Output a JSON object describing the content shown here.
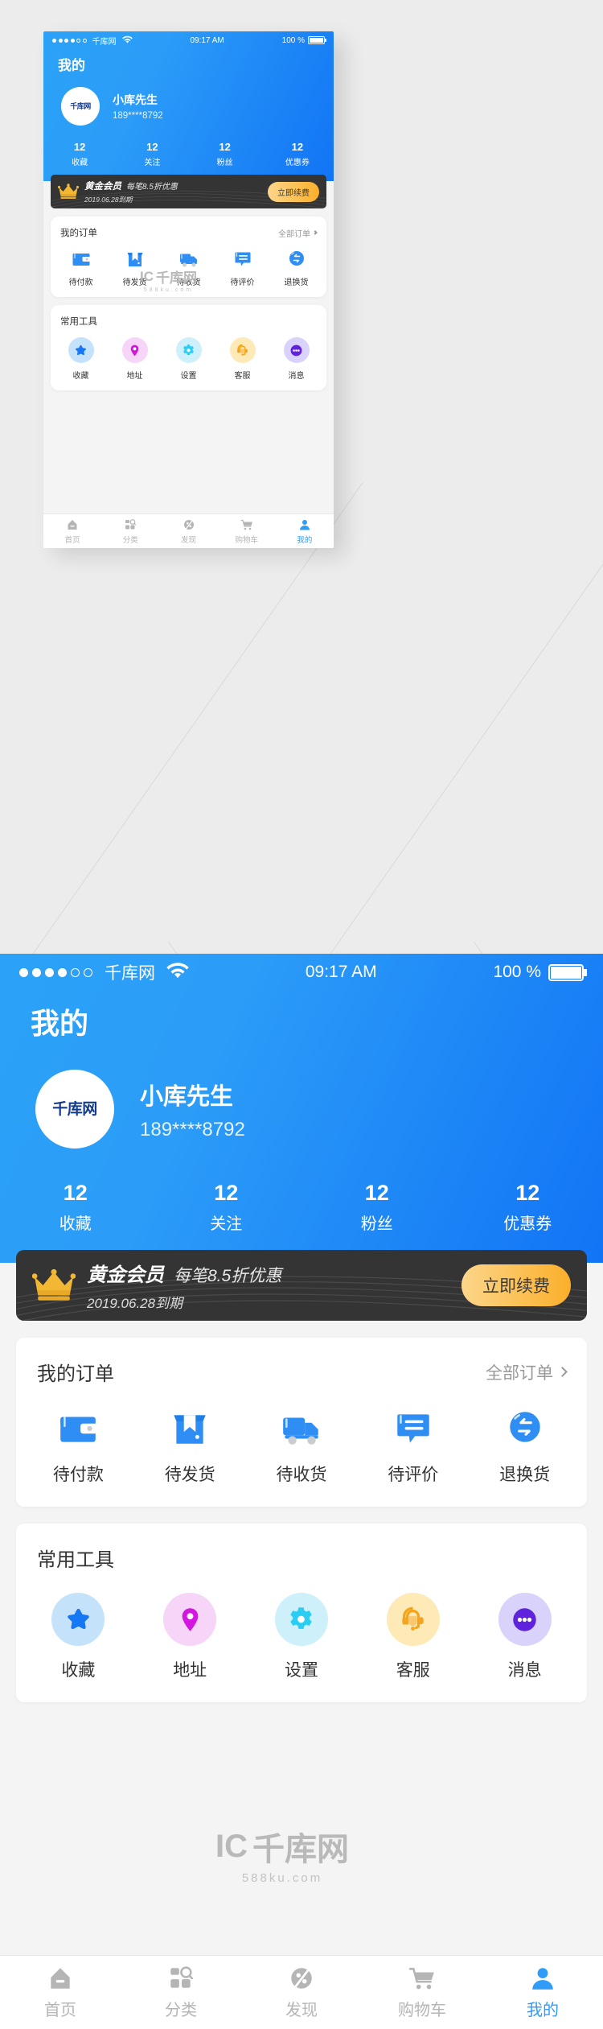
{
  "app": {
    "screen_title": "我的",
    "accent_color": "#2f9cf8",
    "hero_gradient_from": "#2ba2f7",
    "hero_gradient_to": "#1274f5"
  },
  "status_bar": {
    "carrier": "千库网",
    "signal_dots_filled": 4,
    "signal_dots_total": 6,
    "wifi_icon": "wifi-icon",
    "time": "09:17 AM",
    "battery_text": "100 %",
    "battery_level": 100
  },
  "profile": {
    "avatar_logo_text": "千库网",
    "name": "小库先生",
    "phone": "189****8792"
  },
  "stats": [
    {
      "value": "12",
      "label": "收藏"
    },
    {
      "value": "12",
      "label": "关注"
    },
    {
      "value": "12",
      "label": "粉丝"
    },
    {
      "value": "12",
      "label": "优惠券"
    }
  ],
  "vip_banner": {
    "crown_icon": "crown-icon",
    "title": "黄金会员",
    "subtitle": "每笔8.5折优惠",
    "expiry": "2019.06.28到期",
    "renew_label": "立即续费",
    "background_color": "#343434",
    "button_gradient_from": "#fcd68a",
    "button_gradient_to": "#fbaf2a"
  },
  "orders_card": {
    "title": "我的订单",
    "more_label": "全部订单",
    "more_icon": "chevron-right-icon",
    "items": [
      {
        "label": "待付款",
        "icon": "wallet-icon"
      },
      {
        "label": "待发货",
        "icon": "package-icon"
      },
      {
        "label": "待收货",
        "icon": "truck-icon"
      },
      {
        "label": "待评价",
        "icon": "comment-icon"
      },
      {
        "label": "退换货",
        "icon": "return-icon"
      }
    ]
  },
  "tools_card": {
    "title": "常用工具",
    "items": [
      {
        "label": "收藏",
        "icon": "star-icon",
        "bg": "#c5e2fb",
        "fg": "#1677f5"
      },
      {
        "label": "地址",
        "icon": "location-pin-icon",
        "bg": "#f6d5f8",
        "fg": "#d317e0"
      },
      {
        "label": "设置",
        "icon": "gear-icon",
        "bg": "#cdf0fb",
        "fg": "#2ccdf3"
      },
      {
        "label": "客服",
        "icon": "headset-icon",
        "bg": "#fdeab6",
        "fg": "#f6a41c"
      },
      {
        "label": "消息",
        "icon": "message-dots-icon",
        "bg": "#d9d2fb",
        "fg": "#5f22dd"
      }
    ]
  },
  "tabbar": {
    "items": [
      {
        "label": "首页",
        "icon": "home-icon",
        "active": false
      },
      {
        "label": "分类",
        "icon": "category-icon",
        "active": false
      },
      {
        "label": "发现",
        "icon": "discover-icon",
        "active": false
      },
      {
        "label": "购物车",
        "icon": "cart-icon",
        "active": false
      },
      {
        "label": "我的",
        "icon": "user-icon",
        "active": true
      }
    ]
  },
  "watermark": {
    "mark": "IC",
    "brand": "千库网",
    "url": "588ku.com"
  }
}
